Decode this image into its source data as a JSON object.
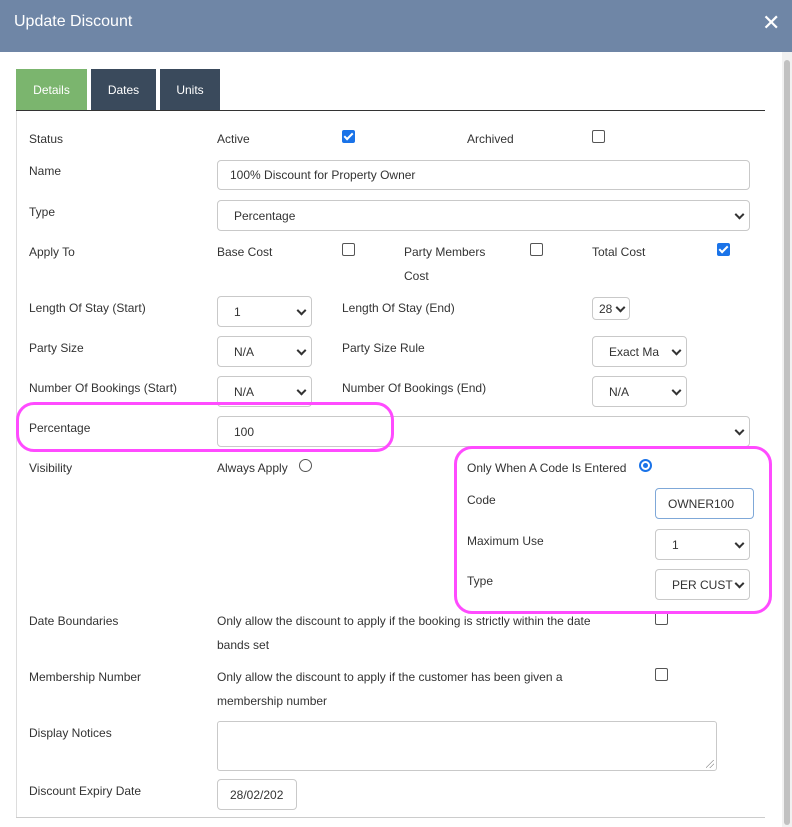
{
  "dialog": {
    "title": "Update Discount",
    "close_glyph": "✕"
  },
  "tabs": [
    {
      "label": "Details"
    },
    {
      "label": "Dates"
    },
    {
      "label": "Units"
    }
  ],
  "form": {
    "status": {
      "label": "Status",
      "active_label": "Active",
      "active_checked": true,
      "archived_label": "Archived",
      "archived_checked": false
    },
    "name": {
      "label": "Name",
      "value": "100% Discount for Property Owner"
    },
    "type": {
      "label": "Type",
      "value": "Percentage"
    },
    "apply_to": {
      "label": "Apply To",
      "base_cost_label": "Base Cost",
      "base_cost_checked": false,
      "party_members_label_1": "Party Members",
      "party_members_label_2": "Cost",
      "party_members_checked": false,
      "total_cost_label": "Total Cost",
      "total_cost_checked": true
    },
    "length_of_stay": {
      "start_label": "Length Of Stay (Start)",
      "start_value": "1",
      "end_label": "Length Of Stay (End)",
      "end_value": "28"
    },
    "party_size": {
      "label": "Party Size",
      "value": "N/A",
      "rule_label": "Party Size Rule",
      "rule_value": "Exact Ma"
    },
    "bookings": {
      "start_label": "Number Of Bookings (Start)",
      "start_value": "N/A",
      "end_label": "Number Of Bookings (End)",
      "end_value": "N/A"
    },
    "percentage": {
      "label": "Percentage",
      "value": "100"
    },
    "visibility": {
      "label": "Visibility",
      "always_label": "Always Apply",
      "always_selected": false,
      "code_only_label": "Only When A Code Is Entered",
      "code_only_selected": true,
      "code_label": "Code",
      "code_value": "OWNER100",
      "max_use_label": "Maximum Use",
      "max_use_value": "1",
      "type_label": "Type",
      "type_value": "PER CUST"
    },
    "date_boundaries": {
      "label": "Date Boundaries",
      "text_1": "Only allow the discount to apply if the booking is strictly within the date",
      "text_2": "bands set",
      "checked": false
    },
    "membership": {
      "label": "Membership Number",
      "text_1": "Only allow the discount to apply if the customer has been given a",
      "text_2": "membership number",
      "checked": false
    },
    "notices": {
      "label": "Display Notices",
      "value": ""
    },
    "expiry": {
      "label": "Discount Expiry Date",
      "value": "28/02/202"
    }
  },
  "colors": {
    "header": "#6f86a6",
    "tab_active": "#7bb56e",
    "tab_inactive": "#3a4a5c",
    "highlight": "#ff4bff",
    "check": "#1a73e8"
  }
}
